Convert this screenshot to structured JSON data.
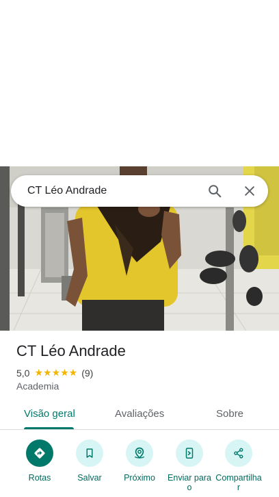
{
  "search": {
    "query": "CT Léo Andrade"
  },
  "place": {
    "name": "CT Léo Andrade",
    "rating": "5,0",
    "stars": "★★★★★",
    "review_count": "(9)",
    "category": "Academia"
  },
  "tabs": [
    {
      "label": "Visão geral",
      "active": true
    },
    {
      "label": "Avaliações",
      "active": false
    },
    {
      "label": "Sobre",
      "active": false
    }
  ],
  "actions": [
    {
      "label": "Rotas",
      "icon": "directions-icon"
    },
    {
      "label": "Salvar",
      "icon": "bookmark-icon"
    },
    {
      "label": "Próximo",
      "icon": "nearby-icon"
    },
    {
      "label": "Enviar para o ",
      "icon": "send-to-phone-icon"
    },
    {
      "label": "Compartilhar",
      "icon": "share-icon"
    }
  ],
  "colors": {
    "accent": "#00796b",
    "action_bg": "#d7f5f4",
    "star": "#f4b400"
  }
}
